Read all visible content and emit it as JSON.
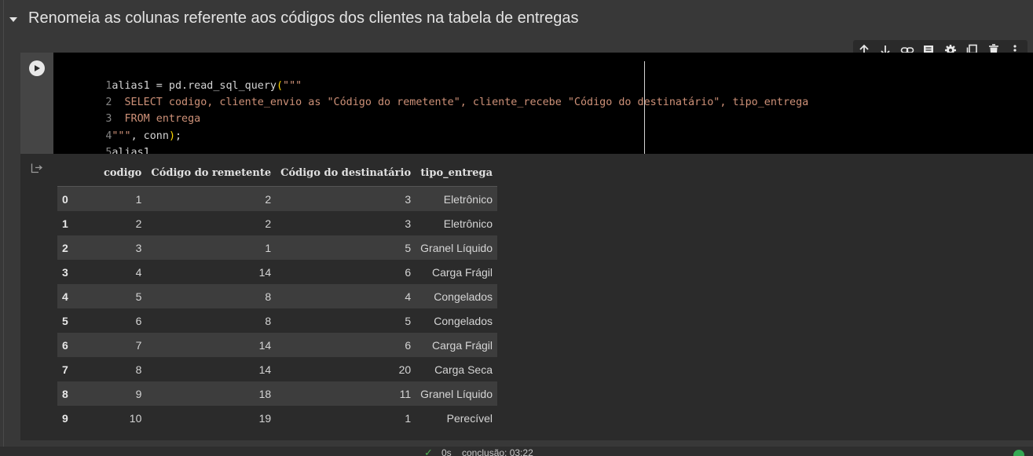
{
  "section": {
    "title": "Renomeia as colunas referente aos códigos dos clientes na tabela de entregas"
  },
  "toolbar": {
    "icons": [
      "arrow-up-icon",
      "arrow-down-icon",
      "link-icon",
      "comment-icon",
      "gear-icon",
      "mirror-cell-icon",
      "trash-icon",
      "more-vert-icon"
    ]
  },
  "code": {
    "lines": [
      {
        "num": "1",
        "text": "alias1 = pd.read_sql_query(\"\"\""
      },
      {
        "num": "2",
        "text": "  SELECT codigo, cliente_envio as \"Código do remetente\", cliente_recebe \"Código do destinatário\", tipo_entrega"
      },
      {
        "num": "3",
        "text": "  FROM entrega"
      },
      {
        "num": "4",
        "text": "\"\"\", conn);"
      },
      {
        "num": "5",
        "text": "alias1"
      }
    ]
  },
  "output": {
    "columns": [
      "",
      "codigo",
      "Código do remetente",
      "Código do destinatário",
      "tipo_entrega"
    ],
    "rows": [
      [
        "0",
        "1",
        "2",
        "3",
        "Eletrônico"
      ],
      [
        "1",
        "2",
        "2",
        "3",
        "Eletrônico"
      ],
      [
        "2",
        "3",
        "1",
        "5",
        "Granel Líquido"
      ],
      [
        "3",
        "4",
        "14",
        "6",
        "Carga Frágil"
      ],
      [
        "4",
        "5",
        "8",
        "4",
        "Congelados"
      ],
      [
        "5",
        "6",
        "8",
        "5",
        "Congelados"
      ],
      [
        "6",
        "7",
        "14",
        "6",
        "Carga Frágil"
      ],
      [
        "7",
        "8",
        "14",
        "20",
        "Carga Seca"
      ],
      [
        "8",
        "9",
        "18",
        "11",
        "Granel Líquido"
      ],
      [
        "9",
        "10",
        "19",
        "1",
        "Perecível"
      ]
    ]
  },
  "status": {
    "check": "✓",
    "text": "0s    conclusão: 03:22"
  },
  "colors": {
    "background": "#383838",
    "editor": "#000000",
    "string": "#ce9178",
    "success": "#34a853"
  }
}
